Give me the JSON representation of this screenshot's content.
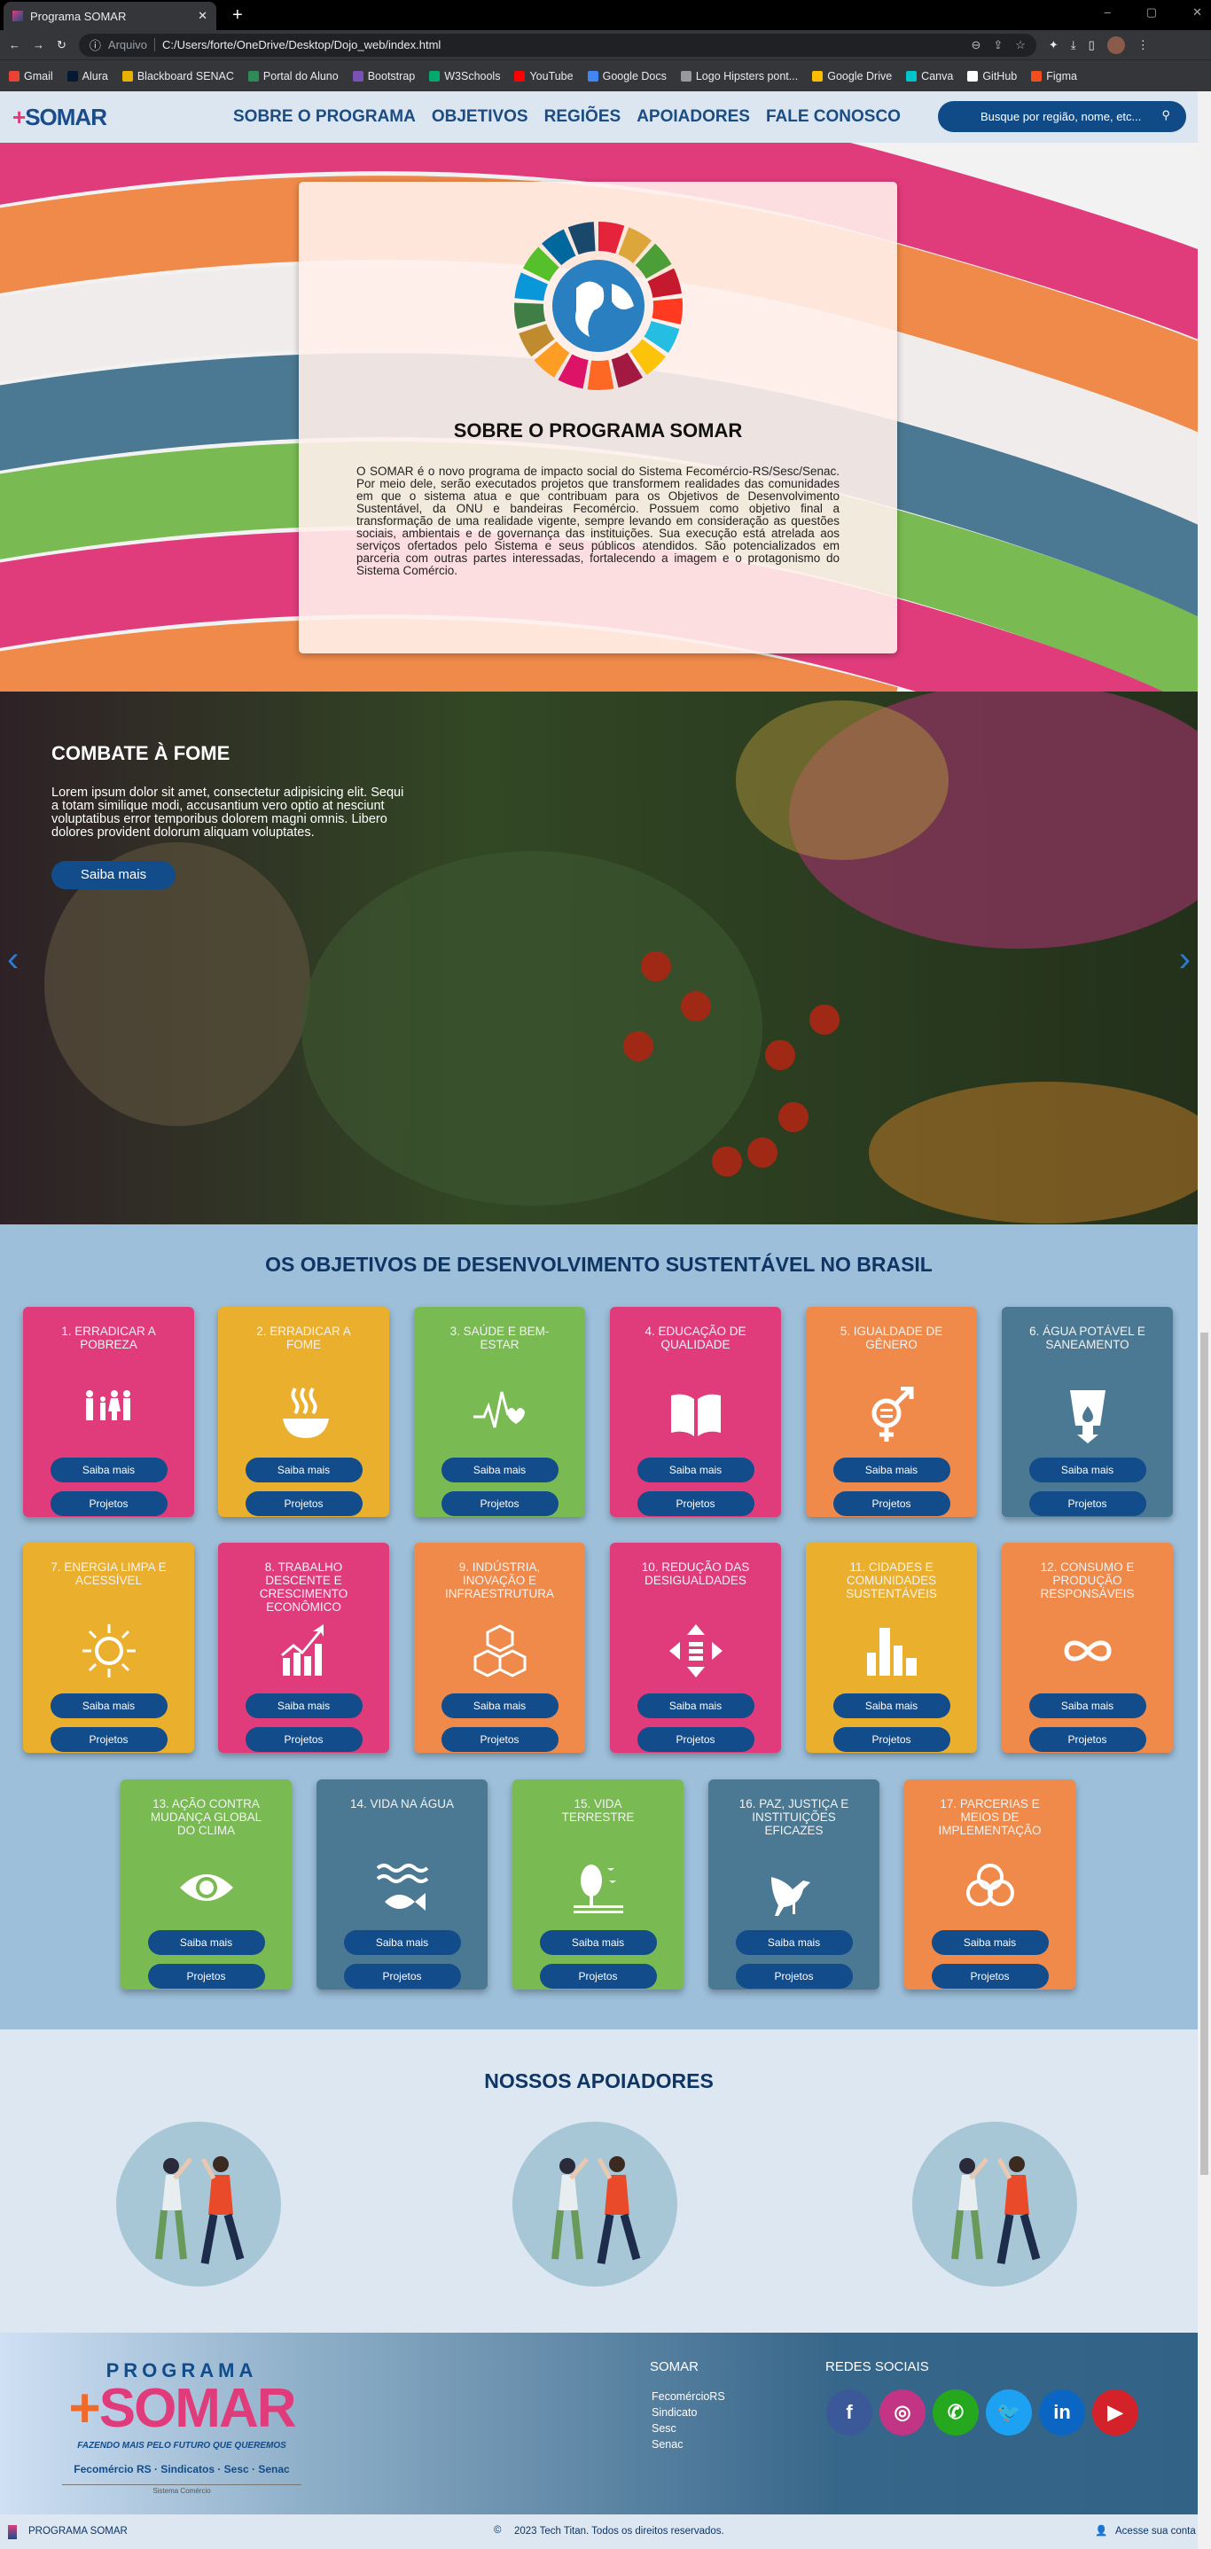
{
  "browser": {
    "tab_title": "Programa SOMAR",
    "address_prefix": "Arquivo",
    "url": "C:/Users/forte/OneDrive/Desktop/Dojo_web/index.html",
    "bookmarks": [
      {
        "label": "Gmail",
        "color": "#ea4335"
      },
      {
        "label": "Alura",
        "color": "#051933"
      },
      {
        "label": "Blackboard SENAC",
        "color": "#e8b100"
      },
      {
        "label": "Portal do Aluno",
        "color": "#2e8b57"
      },
      {
        "label": "Bootstrap",
        "color": "#7952b3"
      },
      {
        "label": "W3Schools",
        "color": "#04aa6d"
      },
      {
        "label": "YouTube",
        "color": "#ff0000"
      },
      {
        "label": "Google Docs",
        "color": "#4285f4"
      },
      {
        "label": "Logo Hipsters pont...",
        "color": "#999999"
      },
      {
        "label": "Google Drive",
        "color": "#fbbc04"
      },
      {
        "label": "Canva",
        "color": "#00c4cc"
      },
      {
        "label": "GitHub",
        "color": "#ffffff"
      },
      {
        "label": "Figma",
        "color": "#f24e1e"
      }
    ]
  },
  "nav": {
    "logo": "SOMAR",
    "links": [
      "SOBRE O PROGRAMA",
      "OBJETIVOS",
      "REGIÕES",
      "APOIADORES",
      "FALE CONOSCO"
    ],
    "search_placeholder": "Busque por região, nome, etc..."
  },
  "about": {
    "title": "SOBRE O PROGRAMA SOMAR",
    "text": "O SOMAR é o novo programa de impacto social do Sistema Fecomércio-RS/Sesc/Senac. Por meio dele, serão executados projetos que transformem realidades das comunidades em que o sistema atua e que contribuam para os Objetivos de Desenvolvimento Sustentável, da ONU e bandeiras Fecomércio. Possuem como objetivo final a transformação de uma realidade vigente, sempre levando em consideração as questões sociais, ambientais e de governança das instituições. Sua execução está atrelada aos serviços ofertados pelo Sistema e seus públicos atendidos. São potencializados em parceria com outras partes interessadas, fortalecendo a imagem e o protagonismo do Sistema Comércio."
  },
  "carousel": {
    "title": "COMBATE À FOME",
    "text": "Lorem ipsum dolor sit amet, consectetur adipisicing elit. Sequi a totam similique modi, accusantium vero optio at nesciunt voluptatibus error temporibus dolorem magni omnis. Libero dolores provident dolorum aliquam voluptates.",
    "button": "Saiba mais"
  },
  "ods": {
    "title": "OS OBJETIVOS DE DESENVOLVIMENTO SUSTENTÁVEL NO BRASIL",
    "btn1": "Saiba mais",
    "btn2": "Projetos",
    "goals": [
      {
        "title": "1. ERRADICAR A POBREZA",
        "color": "#e03c7c",
        "icon": "family-icon"
      },
      {
        "title": "2. ERRADICAR A FOME",
        "color": "#ebaf2e",
        "icon": "bowl-icon"
      },
      {
        "title": "3. SAÚDE E BEM-ESTAR",
        "color": "#79ba52",
        "icon": "heartbeat-icon"
      },
      {
        "title": "4. EDUCAÇÃO DE QUALIDADE",
        "color": "#e03c7c",
        "icon": "book-icon"
      },
      {
        "title": "5. IGUALDADE DE GÊNERO",
        "color": "#ef8a4b",
        "icon": "gender-icon"
      },
      {
        "title": "6. ÁGUA POTÁVEL E SANEAMENTO",
        "color": "#4b7892",
        "icon": "water-glass-icon"
      },
      {
        "title": "7. ENERGIA LIMPA E ACESSÍVEL",
        "color": "#ebaf2e",
        "icon": "sun-icon"
      },
      {
        "title": "8. TRABALHO DESCENTE E CRESCIMENTO ECONÔMICO",
        "color": "#e03c7c",
        "icon": "growth-chart-icon"
      },
      {
        "title": "9. INDÚSTRIA, INOVAÇÃO E INFRAESTRUTURA",
        "color": "#ef8a4b",
        "icon": "cubes-icon"
      },
      {
        "title": "10. REDUÇÃO DAS DESIGUALDADES",
        "color": "#e03c7c",
        "icon": "equality-arrows-icon"
      },
      {
        "title": "11. CIDADES E COMUNIDADES SUSTENTÁVEIS",
        "color": "#ebaf2e",
        "icon": "city-icon"
      },
      {
        "title": "12. CONSUMO E PRODUÇÃO RESPONSÁVEIS",
        "color": "#ef8a4b",
        "icon": "infinity-icon"
      },
      {
        "title": "13. AÇÃO CONTRA MUDANÇA GLOBAL DO CLIMA",
        "color": "#79ba52",
        "icon": "eye-globe-icon"
      },
      {
        "title": "14. VIDA NA ÁGUA",
        "color": "#4b7892",
        "icon": "fish-icon"
      },
      {
        "title": "15. VIDA TERRESTRE",
        "color": "#79ba52",
        "icon": "tree-icon"
      },
      {
        "title": "16. PAZ, JUSTIÇA E INSTITUIÇÕES EFICAZES",
        "color": "#4b7892",
        "icon": "dove-icon"
      },
      {
        "title": "17. PARCERIAS E MEIOS DE IMPLEMENTAÇÃO",
        "color": "#ef8a4b",
        "icon": "rings-icon"
      }
    ]
  },
  "apoiadores": {
    "title": "NOSSOS APOIADORES"
  },
  "footer": {
    "logo_top": "PROGRAMA",
    "logo_main": "SOMAR",
    "slogan": "FAZENDO MAIS PELO FUTURO QUE QUEREMOS",
    "partners": "Fecomércio RS · Sindicatos · Sesc · Senac",
    "system": "Sistema Comércio",
    "somar_heading": "SOMAR",
    "links": [
      "FecomércioRS",
      "Sindicato",
      "Sesc",
      "Senac"
    ],
    "social_heading": "REDES SOCIAIS",
    "social": [
      {
        "name": "facebook",
        "glyph": "f",
        "color": "#3b5998"
      },
      {
        "name": "instagram",
        "glyph": "◎",
        "color": "#c13584"
      },
      {
        "name": "whatsapp",
        "glyph": "✆",
        "color": "#25a71e"
      },
      {
        "name": "twitter",
        "glyph": "🐦",
        "color": "#1da1f2"
      },
      {
        "name": "linkedin",
        "glyph": "in",
        "color": "#0a66c2"
      },
      {
        "name": "youtube",
        "glyph": "▶",
        "color": "#d3222a"
      }
    ]
  },
  "bottom": {
    "brand": "PROGRAMA SOMAR",
    "copyright": "2023 Tech Titan. Todos os direitos reservados.",
    "account": "Acesse sua conta"
  }
}
